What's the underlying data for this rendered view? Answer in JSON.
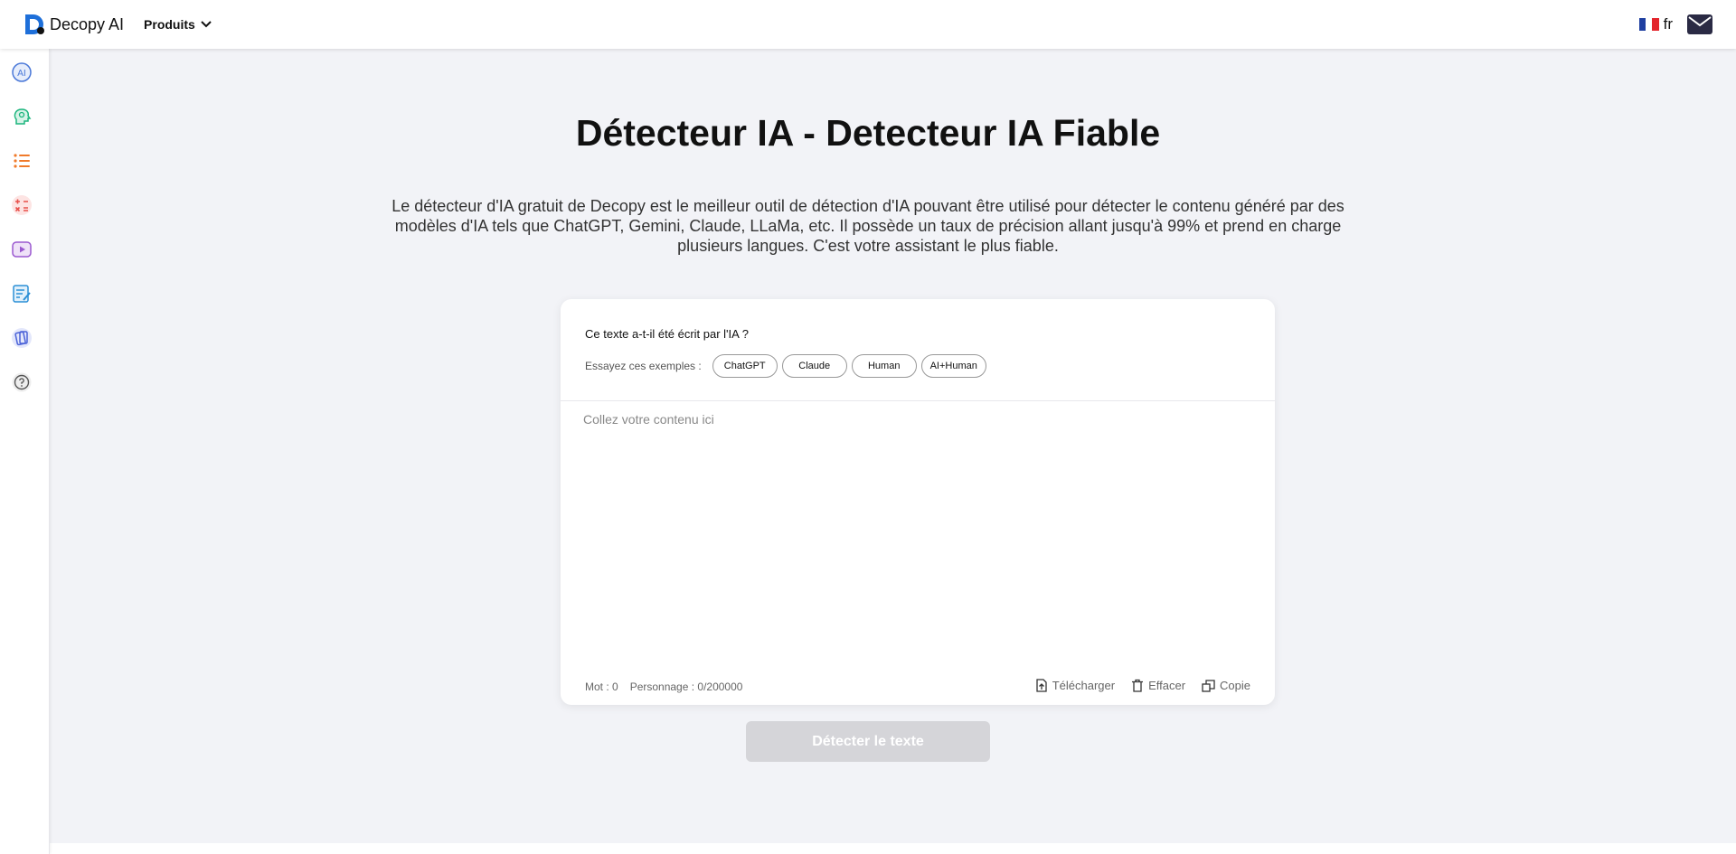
{
  "brand": {
    "name": "Decopy AI"
  },
  "nav": {
    "products_label": "Produits",
    "language": "fr"
  },
  "sidebar": {
    "items": [
      {
        "icon": "ai-icon",
        "color": "#4a78d8"
      },
      {
        "icon": "brain-head-icon",
        "color": "#1bb57d"
      },
      {
        "icon": "list-icon",
        "color": "#f07a2a"
      },
      {
        "icon": "math-operators-icon",
        "color": "#e8504b"
      },
      {
        "icon": "video-play-icon",
        "color": "#9b59d0"
      },
      {
        "icon": "notes-edit-icon",
        "color": "#2b8fd6"
      },
      {
        "icon": "cards-icon",
        "color": "#4a62d8"
      },
      {
        "icon": "help-icon",
        "color": "#555555"
      }
    ]
  },
  "hero": {
    "title": "Détecteur IA - Detecteur IA Fiable",
    "description": "Le détecteur d'IA gratuit de Decopy est le meilleur outil de détection d'IA pouvant être utilisé pour détecter le contenu généré par des modèles d'IA tels que ChatGPT, Gemini, Claude, LLaMa, etc. Il possède un taux de précision allant jusqu'à 99% et prend en charge plusieurs langues. C'est votre assistant le plus fiable."
  },
  "detector": {
    "question": "Ce texte a-t-il été écrit par l'IA ?",
    "examples_label": "Essayez ces exemples :",
    "examples": [
      "ChatGPT",
      "Claude",
      "Human",
      "AI+Human"
    ],
    "placeholder": "Collez votre contenu ici",
    "word_count": "Mot : 0",
    "char_count": "Personnage : 0/200000",
    "upload_label": "Télécharger",
    "clear_label": "Effacer",
    "copy_label": "Copie",
    "detect_label": "Détecter le texte"
  },
  "colors": {
    "brand_blue": "#1e6fd9",
    "button_disabled": "#d5d5d9",
    "background": "#f2f3f7"
  }
}
